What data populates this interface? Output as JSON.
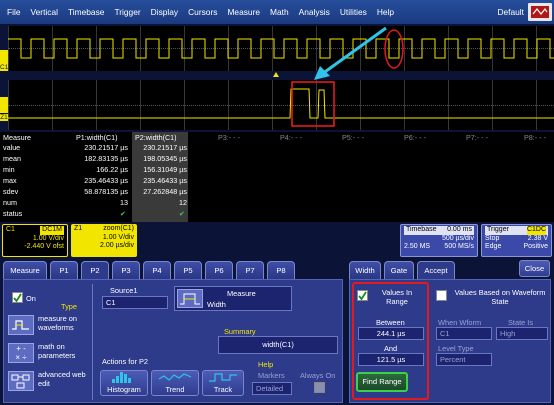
{
  "menu": {
    "items": [
      "File",
      "Vertical",
      "Timebase",
      "Trigger",
      "Display",
      "Cursors",
      "Measure",
      "Math",
      "Analysis",
      "Utilities",
      "Help"
    ],
    "setup_label": "Default"
  },
  "channels": {
    "c1": "C1",
    "z1": "Z1"
  },
  "measure": {
    "header": {
      "label": "Measure",
      "p1": "P1:width(C1)",
      "p2": "P2:width(C1)",
      "p3": "P3:- - -",
      "p4": "P4:- - -",
      "p5": "P5:- - -",
      "p6": "P6:- - -",
      "p7": "P7:- - -",
      "p8": "P8:- - -"
    },
    "rows": [
      {
        "label": "value",
        "p1": "230.21517 µs",
        "p2": "230.21517 µs"
      },
      {
        "label": "mean",
        "p1": "182.83135 µs",
        "p2": "198.05345 µs"
      },
      {
        "label": "min",
        "p1": "166.22 µs",
        "p2": "156.31049 µs"
      },
      {
        "label": "max",
        "p1": "235.46433 µs",
        "p2": "235.46433 µs"
      },
      {
        "label": "sdev",
        "p1": "58.878135 µs",
        "p2": "27.262848 µs"
      },
      {
        "label": "num",
        "p1": "13",
        "p2": "12"
      },
      {
        "label": "status",
        "p1": "✔",
        "p2": "✔"
      }
    ]
  },
  "descriptors": {
    "c1": {
      "name": "C1",
      "coupling": "DC1M",
      "vdiv": "1.00 V/div",
      "offset": "-2.440 V ofst"
    },
    "z1": {
      "name": "Z1",
      "title": "zoom(C1)",
      "vdiv": "1.00 V/div",
      "tdiv": "2.00 µs/div"
    },
    "timebase": {
      "label": "Timebase",
      "delay": "0.00 ms",
      "tdiv": "500 µs/div",
      "samples": "2.50 MS",
      "rate": "500 MS/s"
    },
    "trigger": {
      "label": "Trigger",
      "source": "C1DC",
      "mode": "Stop",
      "level": "2.38 V",
      "type": "Edge",
      "slope": "Positive"
    }
  },
  "tabs": [
    "Measure",
    "P1",
    "P2",
    "P3",
    "P4",
    "P5",
    "P6",
    "P7",
    "P8"
  ],
  "left_panel": {
    "on_label": "On",
    "type_label": "Type",
    "types": [
      "measure on waveforms",
      "math on parameters",
      "advanced web edit"
    ],
    "source_label": "Source1",
    "source_value": "C1",
    "measure_label": "Measure",
    "measure_value": "Width",
    "summary_label": "Summary",
    "summary_value": "width(C1)",
    "actions_label": "Actions for P2",
    "action_buttons": [
      "Histogram",
      "Trend",
      "Track"
    ],
    "help_label": "Help",
    "markers_label": "Markers",
    "markers_value": "Detailed",
    "always_on_label": "Always On"
  },
  "right_panel": {
    "tabs": [
      "Width",
      "Gate",
      "Accept"
    ],
    "close_label": "Close",
    "values_in_range": "Values In Range",
    "between_label": "Between",
    "between_value": "244.1 µs",
    "and_label": "And",
    "and_value": "121.5 µs",
    "find_range": "Find Range",
    "values_based": "Values Based on Waveform State",
    "when_wform": "When Wform",
    "when_value": "C1",
    "state_is": "State Is",
    "state_value": "High",
    "level_type": "Level Type",
    "level_value": "Percent"
  },
  "colors": {
    "trace": "#f2e600",
    "annotation_red": "#e11b1b",
    "annotation_cyan": "#2fc4e8",
    "panel": "#2e3a8a"
  }
}
